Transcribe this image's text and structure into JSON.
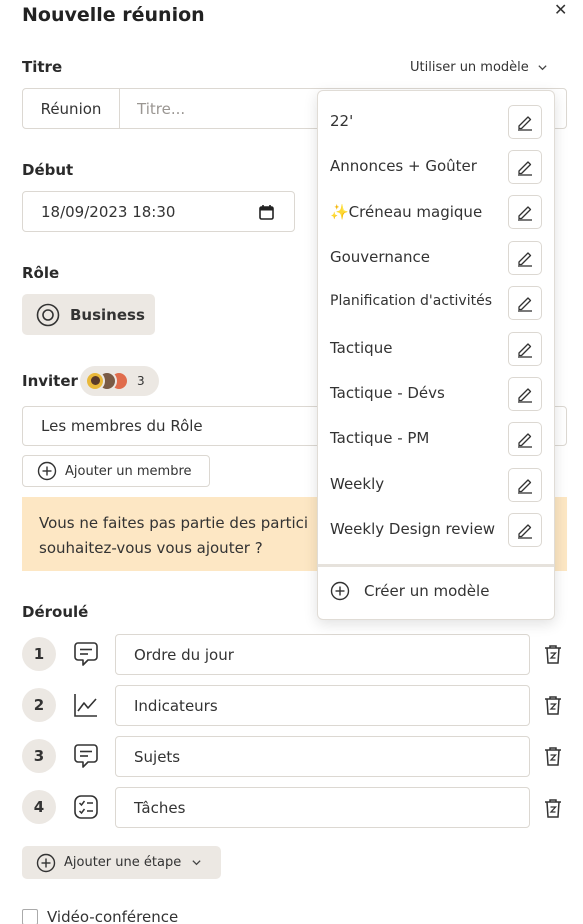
{
  "header": {
    "title": "Nouvelle réunion",
    "close_glyph": "✕"
  },
  "titre": {
    "label": "Titre",
    "model_link": "Utiliser un modèle",
    "prefix": "Réunion",
    "placeholder": "Titre..."
  },
  "debut": {
    "label": "Début",
    "value": "18/09/2023 18:30"
  },
  "role": {
    "label": "Rôle",
    "chip": "Business"
  },
  "inviter": {
    "label": "Inviter",
    "count": "3",
    "field_value": "Les membres du Rôle",
    "add_member": "Ajouter un membre"
  },
  "warning": {
    "line1": "Vous ne faites pas partie des partici",
    "line2": "souhaitez-vous vous ajouter ?"
  },
  "deroule": {
    "label": "Déroulé",
    "steps": [
      {
        "num": "1",
        "icon": "chat-icon",
        "value": "Ordre du jour"
      },
      {
        "num": "2",
        "icon": "chart-line-icon",
        "value": "Indicateurs"
      },
      {
        "num": "3",
        "icon": "chat-icon",
        "value": "Sujets"
      },
      {
        "num": "4",
        "icon": "checklist-icon",
        "value": "Tâches"
      }
    ],
    "add_step": "Ajouter une étape"
  },
  "video": {
    "label": "Vidéo-conférence"
  },
  "dropdown": {
    "items": [
      "22'",
      "Annonces + Goûter",
      "✨Créneau magique",
      "Gouvernance",
      "Planification d'activités",
      "Tactique",
      "Tactique - Dévs",
      "Tactique - PM",
      "Weekly",
      "Weekly Design review"
    ],
    "create": "Créer un modèle"
  },
  "colors": {
    "chip_bg": "#ece8e3",
    "warning_bg": "#fde7c4",
    "border": "#dcd8d2",
    "text": "#333333"
  }
}
